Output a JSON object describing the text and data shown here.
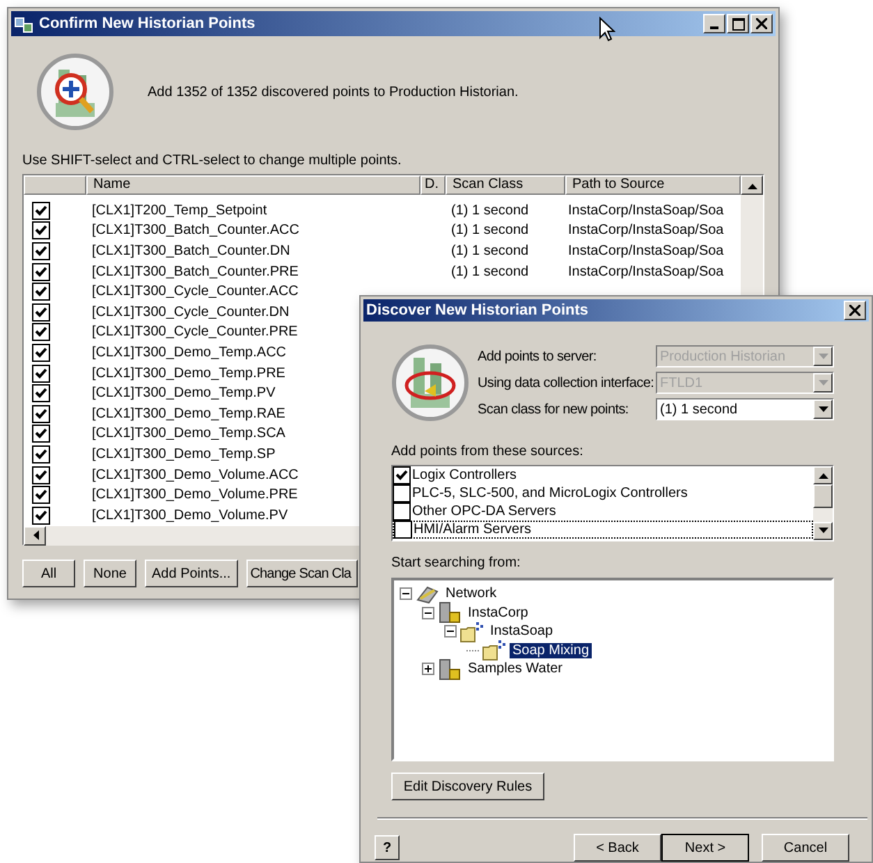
{
  "back_window": {
    "title": "Confirm New Historian Points",
    "message": "Add 1352 of 1352 discovered points to Production Historian.",
    "hint": "Use SHIFT-select and CTRL-select to change multiple points.",
    "table": {
      "columns": [
        "Name",
        "D.",
        "Scan Class",
        "Path to Source"
      ],
      "rows": [
        {
          "checked": true,
          "name": "[CLX1]T200_Temp_Setpoint",
          "scan_class": "(1) 1 second",
          "path": "InstaCorp/InstaSoap/Soa"
        },
        {
          "checked": true,
          "name": "[CLX1]T300_Batch_Counter.ACC",
          "scan_class": "(1) 1 second",
          "path": "InstaCorp/InstaSoap/Soa"
        },
        {
          "checked": true,
          "name": "[CLX1]T300_Batch_Counter.DN",
          "scan_class": "(1) 1 second",
          "path": "InstaCorp/InstaSoap/Soa"
        },
        {
          "checked": true,
          "name": "[CLX1]T300_Batch_Counter.PRE",
          "scan_class": "(1) 1 second",
          "path": "InstaCorp/InstaSoap/Soa"
        },
        {
          "checked": true,
          "name": "[CLX1]T300_Cycle_Counter.ACC"
        },
        {
          "checked": true,
          "name": "[CLX1]T300_Cycle_Counter.DN"
        },
        {
          "checked": true,
          "name": "[CLX1]T300_Cycle_Counter.PRE"
        },
        {
          "checked": true,
          "name": "[CLX1]T300_Demo_Temp.ACC"
        },
        {
          "checked": true,
          "name": "[CLX1]T300_Demo_Temp.PRE"
        },
        {
          "checked": true,
          "name": "[CLX1]T300_Demo_Temp.PV"
        },
        {
          "checked": true,
          "name": "[CLX1]T300_Demo_Temp.RAE"
        },
        {
          "checked": true,
          "name": "[CLX1]T300_Demo_Temp.SCA"
        },
        {
          "checked": true,
          "name": "[CLX1]T300_Demo_Temp.SP"
        },
        {
          "checked": true,
          "name": "[CLX1]T300_Demo_Volume.ACC"
        },
        {
          "checked": true,
          "name": "[CLX1]T300_Demo_Volume.PRE"
        },
        {
          "checked": true,
          "name": "[CLX1]T300_Demo_Volume.PV"
        }
      ]
    },
    "buttons": [
      "All",
      "None",
      "Add Points...",
      "Change Scan Cla"
    ]
  },
  "front_window": {
    "title": "Discover New Historian Points",
    "fields": [
      {
        "label": "Add points to server:",
        "value": "Production Historian",
        "disabled": true
      },
      {
        "label": "Using data collection interface:",
        "value": "FTLD1",
        "disabled": true
      },
      {
        "label": "Scan class for new points:",
        "value": "(1) 1 second",
        "disabled": false
      }
    ],
    "sources_label": "Add points from these sources:",
    "sources": [
      {
        "label": "Logix Controllers",
        "checked": true
      },
      {
        "label": "PLC-5, SLC-500, and MicroLogix Controllers",
        "checked": false
      },
      {
        "label": "Other OPC-DA Servers",
        "checked": false
      },
      {
        "label": "HMI/Alarm Servers",
        "checked": false
      }
    ],
    "tree_label": "Start searching from:",
    "tree": [
      {
        "label": "Network",
        "kind": "network",
        "expanded": true,
        "selected": false,
        "children": [
          {
            "label": "InstaCorp",
            "kind": "server",
            "expanded": true,
            "selected": false,
            "children": [
              {
                "label": "InstaSoap",
                "kind": "area",
                "expanded": true,
                "selected": false,
                "children": [
                  {
                    "label": "Soap Mixing",
                    "kind": "area",
                    "selected": true
                  }
                ]
              }
            ]
          },
          {
            "label": "Samples Water",
            "kind": "server",
            "expanded": false,
            "selected": false
          }
        ]
      }
    ],
    "edit_button": "Edit Discovery Rules",
    "help_button": "?",
    "nav_buttons": [
      {
        "label": "< Back",
        "default": false
      },
      {
        "label": "Next >",
        "default": true
      },
      {
        "label": "Cancel",
        "default": false
      }
    ]
  }
}
